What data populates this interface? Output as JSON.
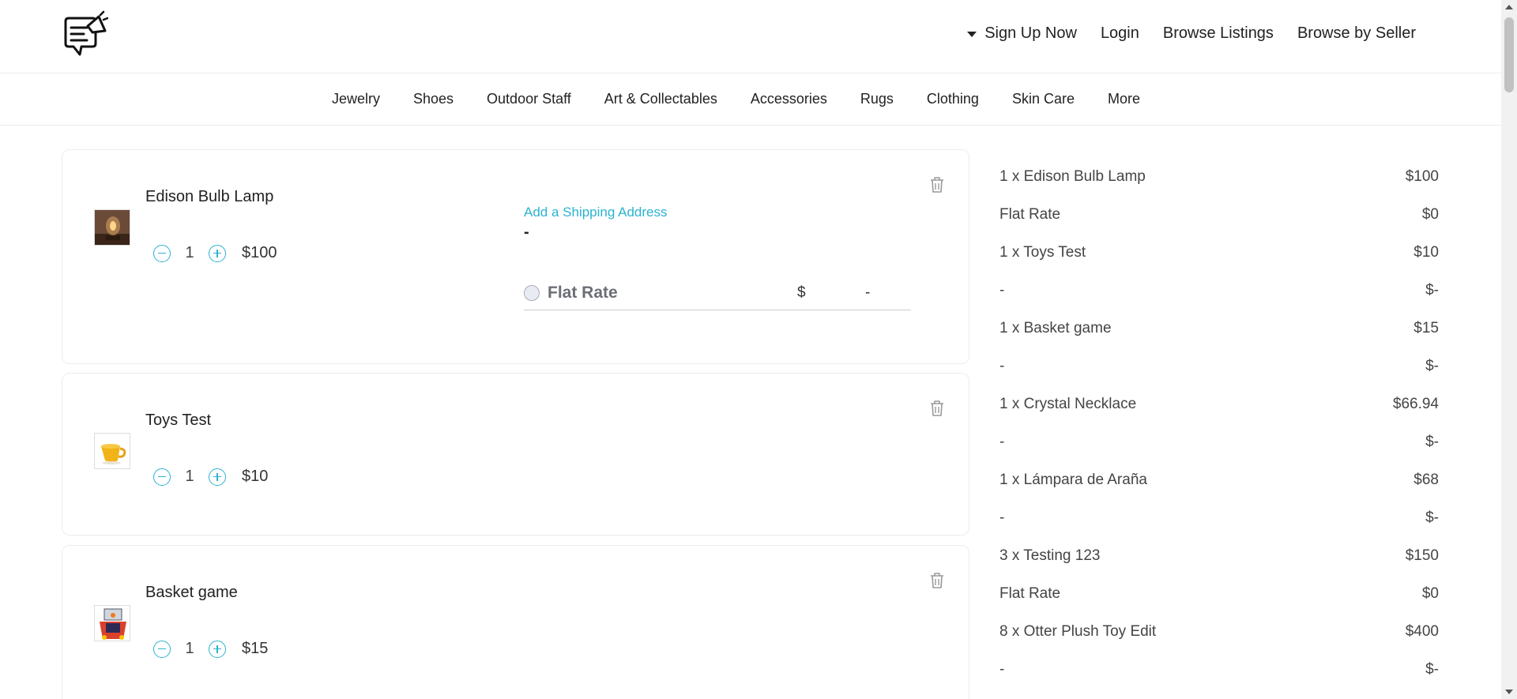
{
  "header": {
    "nav": {
      "signup": "Sign Up Now",
      "login": "Login",
      "browse_listings": "Browse Listings",
      "browse_seller": "Browse by Seller"
    }
  },
  "categories": [
    "Jewelry",
    "Shoes",
    "Outdoor Staff",
    "Art & Collectables",
    "Accessories",
    "Rugs",
    "Clothing",
    "Skin Care",
    "More"
  ],
  "cart": [
    {
      "name": "Edison Bulb Lamp",
      "qty": "1",
      "price": "$100",
      "shipping": {
        "add_link": "Add a Shipping Address",
        "address": "-",
        "rate_label": "Flat Rate",
        "currency": "$",
        "amount": "-"
      }
    },
    {
      "name": "Toys Test",
      "qty": "1",
      "price": "$10"
    },
    {
      "name": "Basket game",
      "qty": "1",
      "price": "$15"
    }
  ],
  "summary": [
    {
      "label": "1 x Edison Bulb Lamp",
      "value": "$100"
    },
    {
      "label": "Flat Rate",
      "value": "$0"
    },
    {
      "label": "1 x Toys Test",
      "value": "$10"
    },
    {
      "label": "-",
      "value": "$-"
    },
    {
      "label": "1 x Basket game",
      "value": "$15"
    },
    {
      "label": "-",
      "value": "$-"
    },
    {
      "label": "1 x Crystal Necklace",
      "value": "$66.94"
    },
    {
      "label": "-",
      "value": "$-"
    },
    {
      "label": "1 x Lámpara de Araña",
      "value": "$68"
    },
    {
      "label": "-",
      "value": "$-"
    },
    {
      "label": "3 x Testing 123",
      "value": "$150"
    },
    {
      "label": "Flat Rate",
      "value": "$0"
    },
    {
      "label": "8 x Otter Plush Toy Edit",
      "value": "$400"
    },
    {
      "label": "-",
      "value": "$-"
    }
  ],
  "colors": {
    "accent": "#2bb3d0",
    "border": "#ececec"
  }
}
